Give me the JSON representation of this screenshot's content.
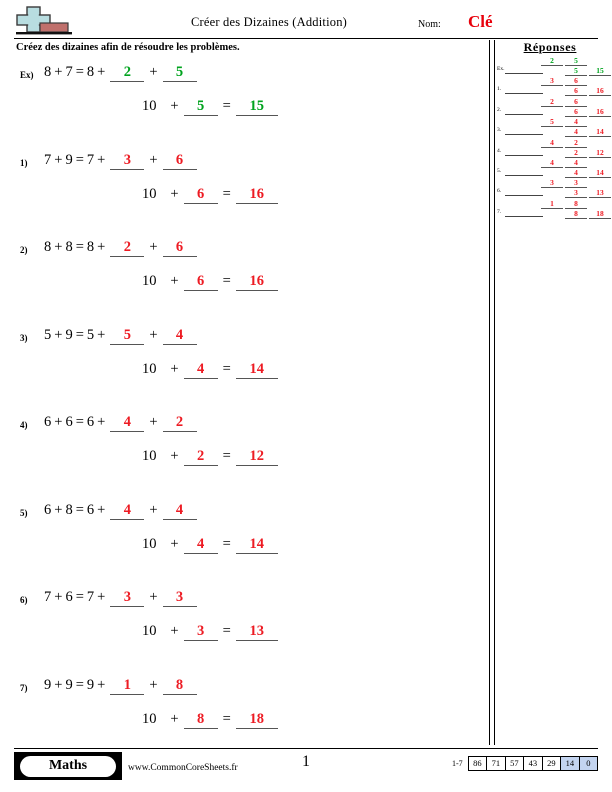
{
  "header": {
    "logo_icon": "plus-block-logo",
    "title": "Créer des Dizaines (Addition)",
    "name_label": "Nom:",
    "name_value": "Clé"
  },
  "instructions": "Créez des dizaines afin de résoudre les problèmes.",
  "answers_panel": {
    "title": "Réponses",
    "rows": [
      {
        "label": "Ex.",
        "color": "green",
        "top": [
          "2",
          "5",
          ""
        ],
        "bottom": [
          "",
          "5",
          "15"
        ]
      },
      {
        "label": "1.",
        "color": "red",
        "top": [
          "3",
          "6",
          ""
        ],
        "bottom": [
          "",
          "6",
          "16"
        ]
      },
      {
        "label": "2.",
        "color": "red",
        "top": [
          "2",
          "6",
          ""
        ],
        "bottom": [
          "",
          "6",
          "16"
        ]
      },
      {
        "label": "3.",
        "color": "red",
        "top": [
          "5",
          "4",
          ""
        ],
        "bottom": [
          "",
          "4",
          "14"
        ]
      },
      {
        "label": "4.",
        "color": "red",
        "top": [
          "4",
          "2",
          ""
        ],
        "bottom": [
          "",
          "2",
          "12"
        ]
      },
      {
        "label": "5.",
        "color": "red",
        "top": [
          "4",
          "4",
          ""
        ],
        "bottom": [
          "",
          "4",
          "14"
        ]
      },
      {
        "label": "6.",
        "color": "red",
        "top": [
          "3",
          "3",
          ""
        ],
        "bottom": [
          "",
          "3",
          "13"
        ]
      },
      {
        "label": "7.",
        "color": "red",
        "top": [
          "1",
          "8",
          ""
        ],
        "bottom": [
          "",
          "8",
          "18"
        ]
      }
    ]
  },
  "problems": [
    {
      "label": "Ex)",
      "color": "green",
      "a": "8",
      "b": "7",
      "base": "8",
      "blank1": "2",
      "blank2": "5",
      "ten": "10",
      "blank3": "5",
      "sum": "15"
    },
    {
      "label": "1)",
      "color": "red",
      "a": "7",
      "b": "9",
      "base": "7",
      "blank1": "3",
      "blank2": "6",
      "ten": "10",
      "blank3": "6",
      "sum": "16"
    },
    {
      "label": "2)",
      "color": "red",
      "a": "8",
      "b": "8",
      "base": "8",
      "blank1": "2",
      "blank2": "6",
      "ten": "10",
      "blank3": "6",
      "sum": "16"
    },
    {
      "label": "3)",
      "color": "red",
      "a": "5",
      "b": "9",
      "base": "5",
      "blank1": "5",
      "blank2": "4",
      "ten": "10",
      "blank3": "4",
      "sum": "14"
    },
    {
      "label": "4)",
      "color": "red",
      "a": "6",
      "b": "6",
      "base": "6",
      "blank1": "4",
      "blank2": "2",
      "ten": "10",
      "blank3": "2",
      "sum": "12"
    },
    {
      "label": "5)",
      "color": "red",
      "a": "6",
      "b": "8",
      "base": "6",
      "blank1": "4",
      "blank2": "4",
      "ten": "10",
      "blank3": "4",
      "sum": "14"
    },
    {
      "label": "6)",
      "color": "red",
      "a": "7",
      "b": "6",
      "base": "7",
      "blank1": "3",
      "blank2": "3",
      "ten": "10",
      "blank3": "3",
      "sum": "13"
    },
    {
      "label": "7)",
      "color": "red",
      "a": "9",
      "b": "9",
      "base": "9",
      "blank1": "1",
      "blank2": "8",
      "ten": "10",
      "blank3": "8",
      "sum": "18"
    }
  ],
  "operators": {
    "plus": "+",
    "equals": "="
  },
  "footer": {
    "badge_label": "Maths",
    "url": "www.CommonCoreSheets.fr",
    "page_number": "1",
    "score_range": "1-7",
    "score_boxes": [
      {
        "value": "86",
        "highlight": false
      },
      {
        "value": "71",
        "highlight": false
      },
      {
        "value": "57",
        "highlight": false
      },
      {
        "value": "43",
        "highlight": false
      },
      {
        "value": "29",
        "highlight": false
      },
      {
        "value": "14",
        "highlight": true
      },
      {
        "value": "0",
        "highlight": true
      }
    ]
  },
  "colors": {
    "answer_green": "#00a31e",
    "answer_red": "#ed1b23",
    "key_red": "#e8000b",
    "score_highlight": "#c3d4f0",
    "logo_blue": "#b8dde0",
    "logo_red": "#c0706c"
  }
}
